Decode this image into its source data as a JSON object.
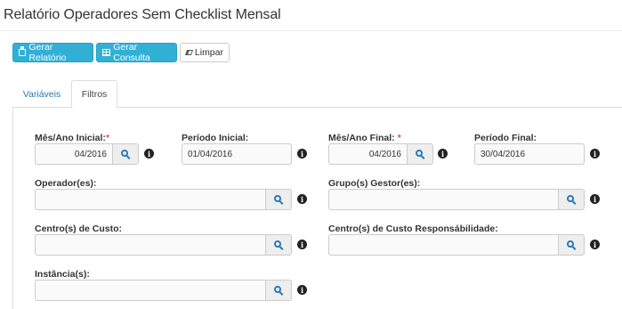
{
  "page": {
    "title": "Relatório Operadores Sem Checklist Mensal"
  },
  "toolbar": {
    "gerar_relatorio": "Gerar Relatório",
    "gerar_consulta": "Gerar Consulta",
    "limpar": "Limpar"
  },
  "tabs": [
    {
      "label": "Variáveis",
      "active": false
    },
    {
      "label": "Filtros",
      "active": true
    }
  ],
  "filters": {
    "mes_ano_inicial": {
      "label": "Mês/Ano Inicial:",
      "required_mark": "*",
      "value": "04/2016"
    },
    "periodo_inicial": {
      "label": "Período Inicial:",
      "value": "01/04/2016"
    },
    "mes_ano_final": {
      "label": "Mês/Ano Final:",
      "required_mark": "*",
      "value": "04/2016"
    },
    "periodo_final": {
      "label": "Período Final:",
      "value": "30/04/2016"
    },
    "operadores": {
      "label": "Operador(es):",
      "value": ""
    },
    "grupos_gestor": {
      "label": "Grupo(s) Gestor(es):",
      "value": ""
    },
    "centros_custo": {
      "label": "Centro(s) de Custo:",
      "value": ""
    },
    "centros_custo_resp": {
      "label": "Centro(s) de Custo Responsábilidade:",
      "value": ""
    },
    "instancias": {
      "label": "Instância(s):",
      "value": ""
    }
  },
  "colors": {
    "primary": "#31b0d5",
    "link": "#2a7ab8",
    "required": "#d9534f"
  },
  "icons": {
    "print": "print-icon",
    "table": "table-icon",
    "eraser": "eraser-icon",
    "search": "search-icon",
    "info": "info-circle-icon"
  }
}
